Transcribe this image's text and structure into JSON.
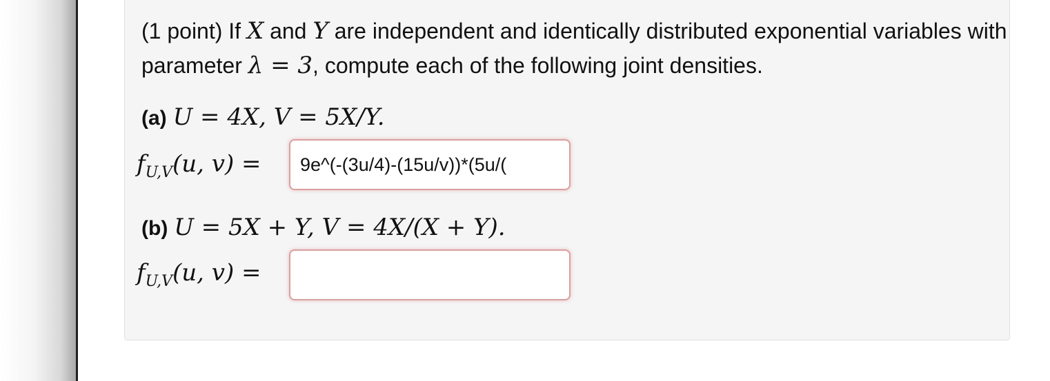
{
  "intro": {
    "prefix": "(1 point) If ",
    "X": "X",
    "and": " and ",
    "Y": "Y",
    "mid": " are independent and identically distributed exponential variables with parameter ",
    "lambda": "λ = 3",
    "suffix": ", compute each of the following joint densities."
  },
  "part_a": {
    "label": "(a)",
    "expression": "U = 4X, V = 5X/Y.",
    "density_label": "f",
    "density_sub": "U,V",
    "density_args": "(u, v) =",
    "answer_value": "9e^(-(3u/4)-(15u/v))*(5u/("
  },
  "part_b": {
    "label": "(b)",
    "expression": "U = 5X + Y, V = 4X/(X + Y).",
    "density_label": "f",
    "density_sub": "U,V",
    "density_args": "(u, v) =",
    "answer_value": ""
  }
}
